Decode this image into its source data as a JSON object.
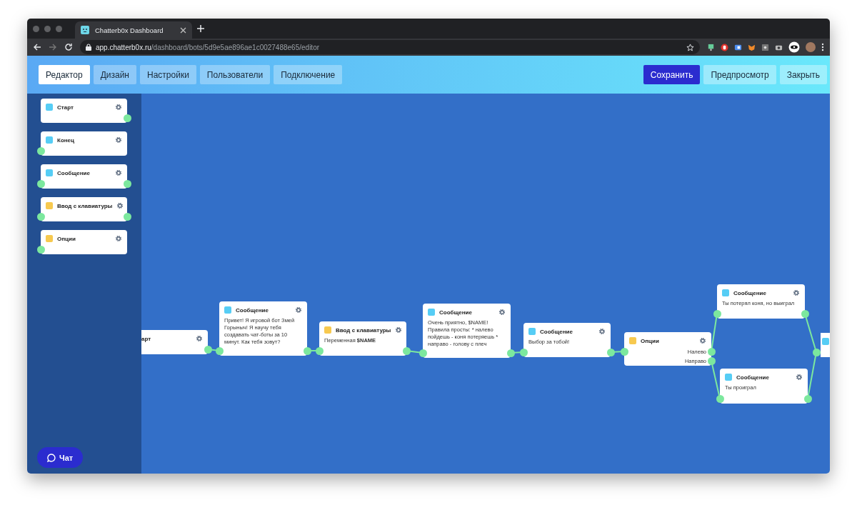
{
  "browser": {
    "tab_title": "Chatterb0x Dashboard",
    "url_host": "app.chatterb0x.ru",
    "url_path": "/dashboard/bots/5d9e5ae896ae1c0027488e65/editor"
  },
  "tabs": [
    {
      "label": "Редактор",
      "selected": true
    },
    {
      "label": "Дизайн",
      "selected": false
    },
    {
      "label": "Настройки",
      "selected": false
    },
    {
      "label": "Пользователи",
      "selected": false
    },
    {
      "label": "Подключение",
      "selected": false
    }
  ],
  "actions": [
    {
      "label": "Сохранить",
      "kind": "primary"
    },
    {
      "label": "Предпросмотр",
      "kind": "secondary"
    },
    {
      "label": "Закрыть",
      "kind": "secondary"
    }
  ],
  "palette": [
    {
      "title": "Старт",
      "color": "#56cdf5",
      "input": false,
      "output": true
    },
    {
      "title": "Конец",
      "color": "#56cdf5",
      "input": true,
      "output": false
    },
    {
      "title": "Сообщение",
      "color": "#56cdf5",
      "input": true,
      "output": true
    },
    {
      "title": "Ввод с клавиатуры",
      "color": "#f7c94f",
      "input": true,
      "output": true
    },
    {
      "title": "Опции",
      "color": "#f7c94f",
      "input": true,
      "output": false
    }
  ],
  "canvas": {
    "nodes": [
      {
        "kind": "clipped-left",
        "title": "арт",
        "input": false,
        "output": true
      },
      {
        "kind": "node",
        "title": "Сообщение",
        "color": "#56cdf5",
        "text": "Привет! Я игровой бот Змей Горыныч! Я научу тебя создавать чат-боты за 10 минут. Как тебя зовут?",
        "input": true,
        "output": true
      },
      {
        "kind": "node",
        "title": "Ввод с клавиатуры",
        "color": "#f7c94f",
        "text": "Переменная **$NAME**",
        "input": true,
        "output": true
      },
      {
        "kind": "node",
        "title": "Сообщение",
        "color": "#56cdf5",
        "text": "Очень приятно, $NAME! Правила просты: * налево пойдешь - коня потеряешь * направо - голову с плеч",
        "input": true,
        "output": true
      },
      {
        "kind": "node",
        "title": "Сообщение",
        "color": "#56cdf5",
        "text": "Выбор за тобой!",
        "input": true,
        "output": true
      },
      {
        "kind": "node",
        "title": "Опции",
        "color": "#f7c94f",
        "options": [
          "Налево",
          "Направо"
        ],
        "input": true,
        "output": false
      },
      {
        "kind": "node",
        "title": "Сообщение",
        "color": "#56cdf5",
        "text": "Ты потерял коня, но выиграл",
        "input": true,
        "output": true
      },
      {
        "kind": "node",
        "title": "Сообщение",
        "color": "#56cdf5",
        "text": "Ты проиграл",
        "input": true,
        "output": true
      },
      {
        "kind": "clipped-right",
        "color": "#56cdf5",
        "input": true,
        "output": false
      }
    ]
  },
  "chat_button": {
    "label": "Чат"
  }
}
